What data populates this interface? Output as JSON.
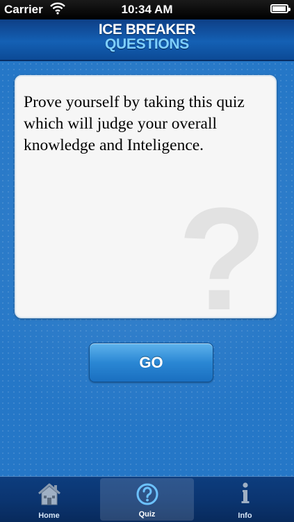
{
  "status_bar": {
    "carrier": "Carrier",
    "time": "10:34 AM",
    "battery_level": 0.95
  },
  "header": {
    "title_line1": "ICE BREAKER",
    "title_line2": "QUESTIONS"
  },
  "card": {
    "text": "Prove yourself by taking this quiz which will judge your overall knowledge and Inteligence.",
    "decoration_glyph": "?"
  },
  "go_button": {
    "label": "GO"
  },
  "tab_bar": {
    "selected": "Quiz",
    "tabs": [
      {
        "label": "Home",
        "icon": "home-icon"
      },
      {
        "label": "Quiz",
        "icon": "question-circle-icon"
      },
      {
        "label": "Info",
        "icon": "info-icon"
      }
    ]
  },
  "colors": {
    "background": "#2577c7",
    "header": "#1460b4",
    "title_accent": "#7fd0ff",
    "tab_bar": "#0b3571"
  }
}
